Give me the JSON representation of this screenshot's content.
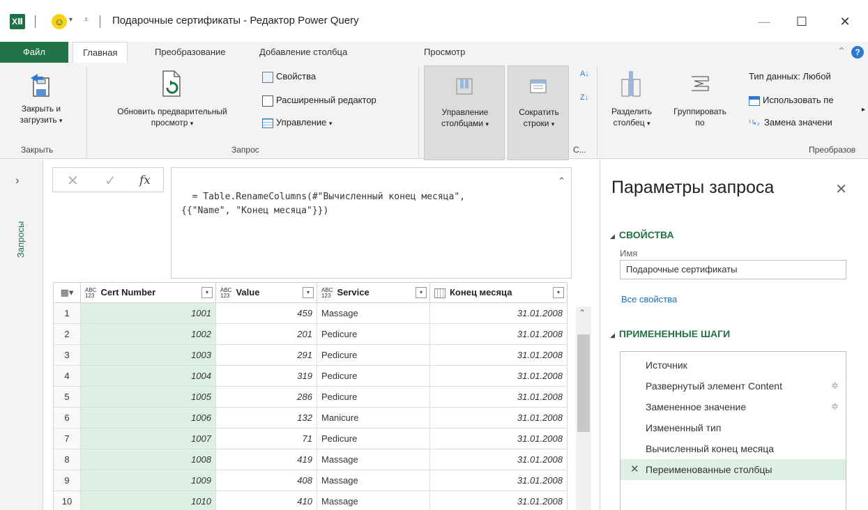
{
  "window": {
    "app_icon": "XⅡ",
    "qat_icon": "smiley-icon",
    "title": "Подарочные сертификаты - Редактор Power Query",
    "controls": {
      "minimize": "—",
      "maximize": "☐",
      "close": "✕"
    }
  },
  "tabs": {
    "file": "Файл",
    "items": [
      "Главная",
      "Преобразование",
      "Добавление столбца",
      "Просмотр"
    ],
    "active": "Главная",
    "help": "?"
  },
  "ribbon": {
    "close_load": {
      "line1": "Закрыть и",
      "line2": "загрузить"
    },
    "refresh": {
      "line1": "Обновить предварительный",
      "line2": "просмотр"
    },
    "properties": "Свойства",
    "advanced_editor": "Расширенный редактор",
    "manage": "Управление",
    "manage_columns": {
      "line1": "Управление",
      "line2": "столбцами"
    },
    "reduce_rows": {
      "line1": "Сократить",
      "line2": "строки"
    },
    "split_column": {
      "line1": "Разделить",
      "line2": "столбец"
    },
    "group_by": {
      "line1": "Группировать",
      "line2": "по"
    },
    "data_type": "Тип данных: Любой",
    "use_first_row": "Использовать пе",
    "replace_values": "Замена значени",
    "groups": {
      "close": "Закрыть",
      "query": "Запрос",
      "sort_short": "С...",
      "transform": "Преобразов"
    }
  },
  "left_pane": {
    "chevron": "›",
    "label": "Запросы"
  },
  "formula_bar": {
    "cancel": "✕",
    "confirm": "✓",
    "fx": "fx",
    "formula": "= Table.RenameColumns(#\"Вычисленный конец месяца\",\n{{\"Name\", \"Конец месяца\"}})"
  },
  "grid": {
    "columns": [
      {
        "type": "ABC 123",
        "name": "Cert Number"
      },
      {
        "type": "ABC 123",
        "name": "Value"
      },
      {
        "type": "ABC 123",
        "name": "Service"
      },
      {
        "type": "calendar",
        "name": "Конец месяца"
      }
    ],
    "rows": [
      [
        "1",
        "1001",
        "459",
        "Massage",
        "31.01.2008"
      ],
      [
        "2",
        "1002",
        "201",
        "Pedicure",
        "31.01.2008"
      ],
      [
        "3",
        "1003",
        "291",
        "Pedicure",
        "31.01.2008"
      ],
      [
        "4",
        "1004",
        "319",
        "Pedicure",
        "31.01.2008"
      ],
      [
        "5",
        "1005",
        "286",
        "Pedicure",
        "31.01.2008"
      ],
      [
        "6",
        "1006",
        "132",
        "Manicure",
        "31.01.2008"
      ],
      [
        "7",
        "1007",
        "71",
        "Pedicure",
        "31.01.2008"
      ],
      [
        "8",
        "1008",
        "419",
        "Massage",
        "31.01.2008"
      ],
      [
        "9",
        "1009",
        "408",
        "Massage",
        "31.01.2008"
      ],
      [
        "10",
        "1010",
        "410",
        "Massage",
        "31.01.2008"
      ]
    ]
  },
  "right_pane": {
    "title": "Параметры запроса",
    "close": "✕",
    "properties_header": "СВОЙСТВА",
    "name_label": "Имя",
    "name_value": "Подарочные сертификаты",
    "all_properties": "Все свойства",
    "steps_header": "ПРИМЕНЕННЫЕ ШАГИ",
    "steps": [
      {
        "label": "Источник",
        "gear": false
      },
      {
        "label": "Развернутый элемент Content",
        "gear": true
      },
      {
        "label": "Замененное значение",
        "gear": true
      },
      {
        "label": "Измененный тип",
        "gear": false
      },
      {
        "label": "Вычисленный конец месяца",
        "gear": false
      },
      {
        "label": "Переименованные столбцы",
        "gear": false,
        "selected": true
      }
    ]
  },
  "colors": {
    "accent_green": "#217346",
    "selected_fill": "#def0e4",
    "link_blue": "#1a6fb5"
  }
}
